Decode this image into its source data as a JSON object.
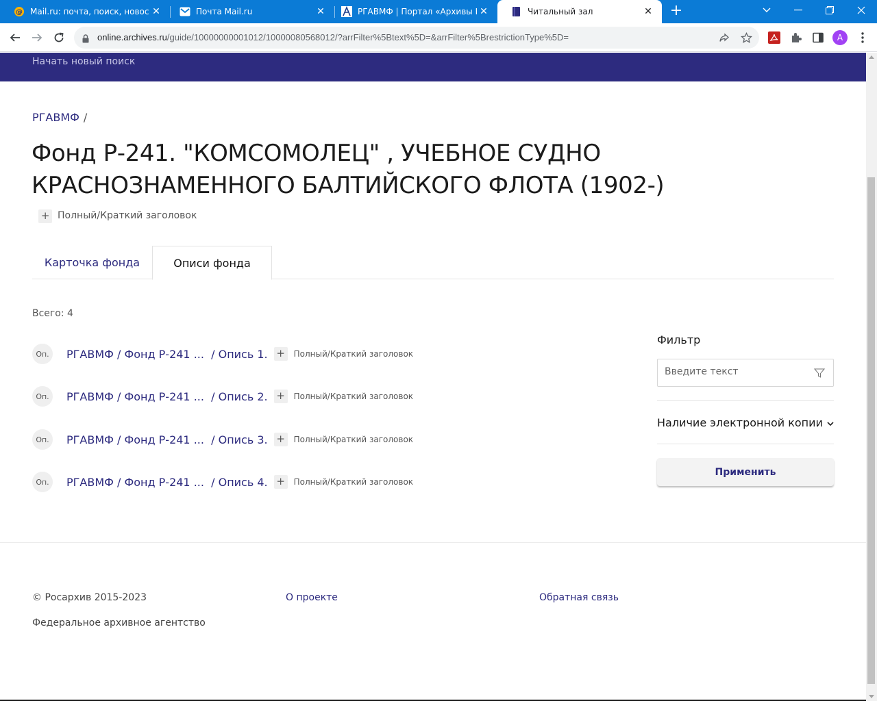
{
  "browser": {
    "tabs": [
      {
        "title": "Mail.ru: почта, поиск, новости, погода",
        "icon": "mailru-at-icon"
      },
      {
        "title": "Почта Mail.ru",
        "icon": "mail-envelope-icon"
      },
      {
        "title": "РГАВМФ | Портал «Архивы России»",
        "icon": "archives-portal-icon"
      },
      {
        "title": "Читальный зал",
        "icon": "book-icon"
      }
    ],
    "url_host": "online.archives.ru",
    "url_path": "/guide/10000000001012/10000080568012/?arrFilter%5Btext%5D=&arrFilter%5BrestrictionType%5D=",
    "profile_initial": "A",
    "colors": {
      "tabstrip": "#0b7bd6",
      "avatar": "#a142f4",
      "pdf_icon": "#c5221f"
    }
  },
  "site": {
    "new_search": "Начать новый поиск",
    "colors": {
      "header": "#2d2b7f",
      "link": "#2d2b7f"
    }
  },
  "breadcrumb": {
    "archive": "РГАВМФ",
    "sep": "/"
  },
  "title": {
    "text": "Фонд Р-241. \"КОМСОМОЛЕЦ\" , УЧЕБНОЕ СУДНО КРАСНОЗНАМЕННОГО БАЛТИЙСКОГО ФЛОТА (1902-)",
    "toggle_label": "Полный/Краткий заголовок",
    "plus": "+"
  },
  "tabs": {
    "card": "Карточка фонда",
    "inventories": "Описи фонда"
  },
  "total": "Всего: 4",
  "inventories": [
    {
      "badge": "Оп.",
      "path": "РГАВМФ / Фонд Р-241 ...",
      "name": "/ Опись 1.",
      "toggle": "Полный/Краткий заголовок"
    },
    {
      "badge": "Оп.",
      "path": "РГАВМФ / Фонд Р-241 ...",
      "name": "/ Опись 2.",
      "toggle": "Полный/Краткий заголовок"
    },
    {
      "badge": "Оп.",
      "path": "РГАВМФ / Фонд Р-241 ...",
      "name": "/ Опись 3.",
      "toggle": "Полный/Краткий заголовок"
    },
    {
      "badge": "Оп.",
      "path": "РГАВМФ / Фонд Р-241 ...",
      "name": "/ Опись 4.",
      "toggle": "Полный/Краткий заголовок"
    }
  ],
  "filter": {
    "title": "Фильтр",
    "placeholder": "Введите текст",
    "value": "",
    "ecopy_label": "Наличие электронной копии",
    "apply": "Применить"
  },
  "footer": {
    "copyright": "© Росархив 2015-2023",
    "agency": "Федеральное архивное агентство",
    "about": "О проекте",
    "feedback": "Обратная связь"
  }
}
